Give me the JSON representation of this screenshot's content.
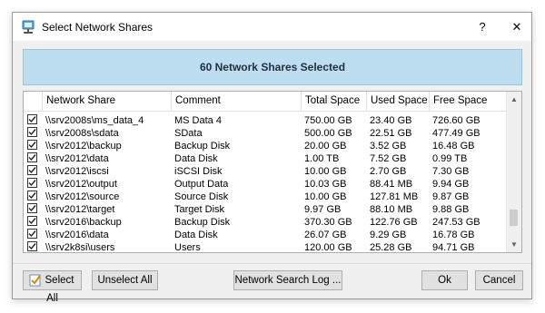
{
  "window": {
    "title": "Select Network Shares",
    "help": "?",
    "close": "✕"
  },
  "banner": {
    "text": "60 Network Shares Selected"
  },
  "table": {
    "columns": [
      "Network Share",
      "Comment",
      "Total Space",
      "Used Space",
      "Free Space"
    ],
    "rows": [
      {
        "share": "\\\\srv2008s\\ms_data_4",
        "comment": "MS Data 4",
        "total": "750.00 GB",
        "used": "23.40 GB",
        "free": "726.60 GB",
        "checked": true
      },
      {
        "share": "\\\\srv2008s\\sdata",
        "comment": "SData",
        "total": "500.00 GB",
        "used": "22.51 GB",
        "free": "477.49 GB",
        "checked": true
      },
      {
        "share": "\\\\srv2012\\backup",
        "comment": "Backup Disk",
        "total": "20.00 GB",
        "used": "3.52 GB",
        "free": "16.48 GB",
        "checked": true
      },
      {
        "share": "\\\\srv2012\\data",
        "comment": "Data Disk",
        "total": "1.00 TB",
        "used": "7.52 GB",
        "free": "0.99 TB",
        "checked": true
      },
      {
        "share": "\\\\srv2012\\iscsi",
        "comment": "iSCSI Disk",
        "total": "10.00 GB",
        "used": "2.70 GB",
        "free": "7.30 GB",
        "checked": true
      },
      {
        "share": "\\\\srv2012\\output",
        "comment": "Output Data",
        "total": "10.03 GB",
        "used": "88.41 MB",
        "free": "9.94 GB",
        "checked": true
      },
      {
        "share": "\\\\srv2012\\source",
        "comment": "Source Disk",
        "total": "10.00 GB",
        "used": "127.81 MB",
        "free": "9.87 GB",
        "checked": true
      },
      {
        "share": "\\\\srv2012\\target",
        "comment": "Target Disk",
        "total": "9.97 GB",
        "used": "88.10 MB",
        "free": "9.88 GB",
        "checked": true
      },
      {
        "share": "\\\\srv2016\\backup",
        "comment": "Backup Disk",
        "total": "370.30 GB",
        "used": "122.76 GB",
        "free": "247.53 GB",
        "checked": true
      },
      {
        "share": "\\\\srv2016\\data",
        "comment": "Data Disk",
        "total": "26.07 GB",
        "used": "9.29 GB",
        "free": "16.78 GB",
        "checked": true
      },
      {
        "share": "\\\\srv2k8si\\users",
        "comment": "Users",
        "total": "120.00 GB",
        "used": "25.28 GB",
        "free": "94.71 GB",
        "checked": true
      }
    ]
  },
  "buttons": {
    "select_all": "Select All",
    "unselect_all": "Unselect All",
    "search_log": "Network Search Log ...",
    "ok": "Ok",
    "cancel": "Cancel"
  },
  "colors": {
    "banner_bg": "#bdddf0",
    "dialog_bg": "#f0f0f0"
  }
}
